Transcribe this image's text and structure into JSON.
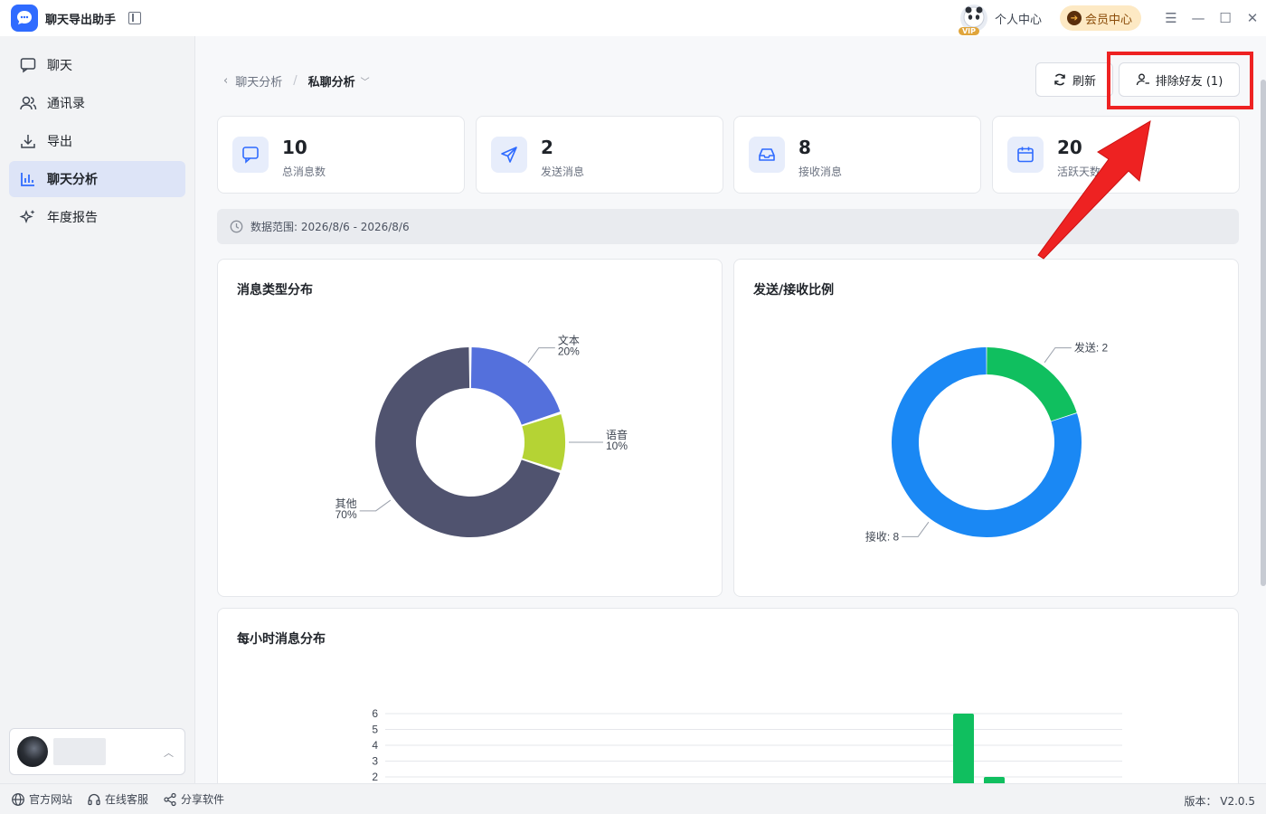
{
  "app": {
    "title": "聊天导出助手"
  },
  "titlebar": {
    "vip_badge": "VIP",
    "personal_center": "个人中心",
    "member_center": "会员中心"
  },
  "sidebar": {
    "items": [
      {
        "label": "聊天",
        "icon": "chat-bubble-icon"
      },
      {
        "label": "通讯录",
        "icon": "contacts-icon"
      },
      {
        "label": "导出",
        "icon": "download-icon"
      },
      {
        "label": "聊天分析",
        "icon": "bar-chart-icon",
        "active": true
      },
      {
        "label": "年度报告",
        "icon": "sparkle-icon"
      }
    ]
  },
  "breadcrumb": {
    "parent": "聊天分析",
    "separator": "/",
    "current": "私聊分析"
  },
  "toolbar": {
    "refresh_label": "刷新",
    "exclude_label": "排除好友 (1)"
  },
  "stats": [
    {
      "value": "10",
      "label": "总消息数",
      "icon": "message-icon"
    },
    {
      "value": "2",
      "label": "发送消息",
      "icon": "send-icon"
    },
    {
      "value": "8",
      "label": "接收消息",
      "icon": "inbox-icon"
    },
    {
      "value": "20",
      "label": "活跃天数",
      "icon": "calendar-icon"
    }
  ],
  "range": {
    "text": "数据范围: 2026/8/6 - 2026/8/6"
  },
  "footer": {
    "website": "官方网站",
    "support": "在线客服",
    "share": "分享软件",
    "version": "版本： V2.0.5"
  },
  "colors": {
    "accent": "#2f6bff",
    "highlight": "#ee2222",
    "text_slice": "#5470dc",
    "voice_slice": "#b5d334",
    "other_slice": "#50536f",
    "send_slice": "#10bf5f",
    "receive_slice": "#1a88f4"
  },
  "chart_data": [
    {
      "type": "pie",
      "title": "消息类型分布",
      "categories": [
        "文本",
        "语音",
        "其他"
      ],
      "values": [
        20,
        10,
        70
      ],
      "labels": [
        "文本\n20%",
        "语音\n10%",
        "其他\n70%"
      ]
    },
    {
      "type": "pie",
      "title": "发送/接收比例",
      "categories": [
        "发送",
        "接收"
      ],
      "values": [
        2,
        8
      ],
      "labels": [
        "发送: 2",
        "接收: 8"
      ]
    },
    {
      "type": "bar",
      "title": "每小时消息分布",
      "y_ticks": [
        2,
        3,
        4,
        5,
        6
      ],
      "ylim": [
        0,
        6
      ],
      "visible_bars": [
        {
          "value": 6,
          "color": "#10bf5f"
        },
        {
          "value": 2,
          "color": "#10bf5f"
        }
      ]
    }
  ]
}
